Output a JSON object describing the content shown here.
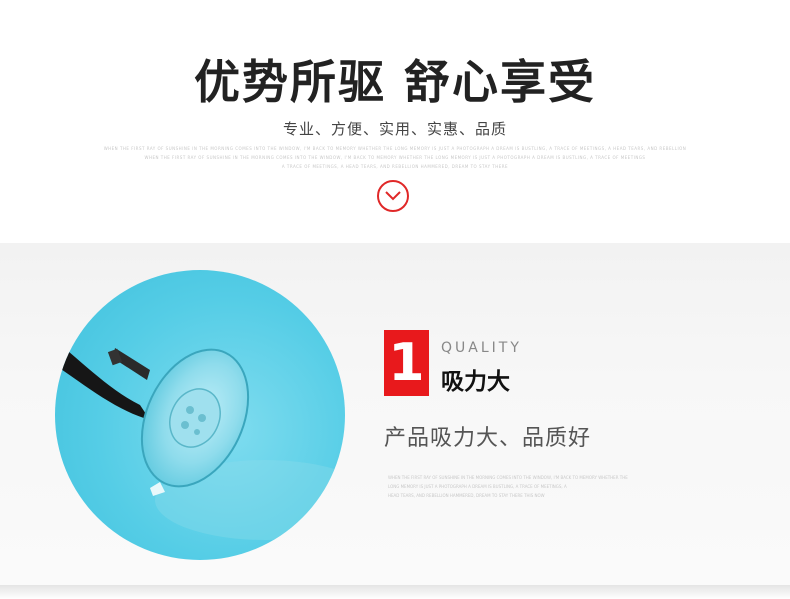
{
  "header": {
    "headline": "优势所驱 舒心享受",
    "subline": "专业、方便、实用、实惠、品质",
    "fine_lines": [
      "WHEN THE FIRST RAY OF SUNSHINE IN THE MORNING COMES INTO THE WINDOW, I'M BACK TO MEMORY WHETHER THE LONG MEMORY IS JUST A PHOTOGRAPH A DREAM IS BUSTLING, A TRACE OF MEETINGS, A HEAD TEARS, AND REBELLION",
      "WHEN THE FIRST RAY OF SUNSHINE IN THE MORNING COMES INTO THE WINDOW, I'M BACK TO MEMORY WHETHER THE LONG MEMORY IS JUST A PHOTOGRAPH A DREAM IS BUSTLING, A TRACE OF MEETINGS",
      "A TRACE OF MEETINGS, A HEAD TEARS, AND REBELLION HAMMERED, DREAM TO STAY THERE"
    ],
    "scroll_icon": "chevron-down-icon",
    "accent": "#e02828"
  },
  "feature": {
    "number": "1",
    "number_bg": "#e8191c",
    "label_en": "QUALITY",
    "title": "吸力大",
    "description": "产品吸力大、品质好",
    "fine_lines": [
      "WHEN THE FIRST RAY OF SUNSHINE IN THE MORNING COMES INTO THE WINDOW, I'M BACK TO MEMORY WHETHER THE",
      "LONG MEMORY IS JUST A PHOTOGRAPH A DREAM IS BUSTLING, A TRACE OF MEETINGS, A",
      "HEAD TEARS, AND REBELLION HAMMERED, DREAM TO STAY THERE THIS NOW"
    ],
    "photo_bg": "#55cde6"
  }
}
